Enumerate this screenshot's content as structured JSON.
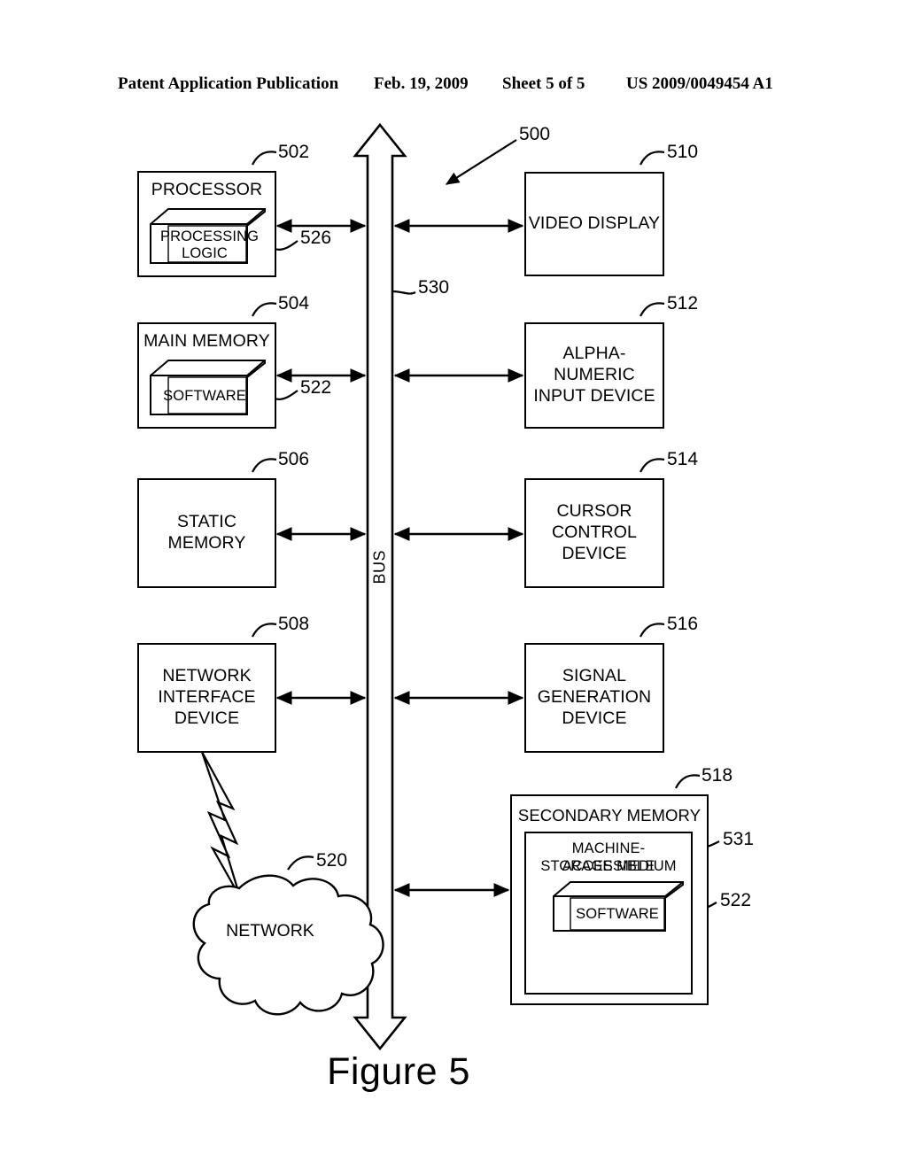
{
  "header": {
    "left": "Patent Application Publication",
    "date": "Feb. 19, 2009",
    "sheet": "Sheet 5 of 5",
    "number": "US 2009/0049454 A1"
  },
  "figure": {
    "caption": "Figure 5",
    "system_ref": "500",
    "bus": {
      "label": "BUS",
      "ref": "530"
    },
    "blocks": [
      {
        "id": "processor",
        "title": "PROCESSOR",
        "ref": "502",
        "inner": {
          "label": "PROCESSING LOGIC",
          "ref": "526"
        }
      },
      {
        "id": "main-memory",
        "title": "MAIN MEMORY",
        "ref": "504",
        "inner": {
          "label": "SOFTWARE",
          "ref": "522"
        }
      },
      {
        "id": "static-memory",
        "title": "STATIC MEMORY",
        "ref": "506"
      },
      {
        "id": "network-interface-device",
        "title": "NETWORK INTERFACE DEVICE",
        "ref": "508"
      },
      {
        "id": "video-display",
        "title": "VIDEO DISPLAY",
        "ref": "510"
      },
      {
        "id": "alpha-numeric-input-device",
        "title": "ALPHA-NUMERIC INPUT DEVICE",
        "ref": "512"
      },
      {
        "id": "cursor-control-device",
        "title": "CURSOR CONTROL DEVICE",
        "ref": "514"
      },
      {
        "id": "signal-generation-device",
        "title": "SIGNAL GENERATION DEVICE",
        "ref": "516"
      },
      {
        "id": "secondary-memory",
        "title": "SECONDARY MEMORY",
        "ref": "518",
        "inner": {
          "label": "MACHINE-ACCESSIBLE STORAGE MEDIUM",
          "ref": "531"
        },
        "inner2": {
          "label": "SOFTWARE",
          "ref": "522"
        }
      }
    ],
    "network": {
      "label": "NETWORK",
      "ref": "520"
    },
    "block_text": {
      "processor": "PROCESSOR",
      "processing_logic_line1": "PROCESSING",
      "processing_logic_line2": "LOGIC",
      "main_memory": "MAIN MEMORY",
      "software": "SOFTWARE",
      "static_memory": "STATIC MEMORY",
      "nid_line1": "NETWORK",
      "nid_line2": "INTERFACE",
      "nid_line3": "DEVICE",
      "video_display": "VIDEO DISPLAY",
      "ani_line1": "ALPHA-NUMERIC",
      "ani_line2": "INPUT DEVICE",
      "ccd_line1": "CURSOR",
      "ccd_line2": "CONTROL",
      "ccd_line3": "DEVICE",
      "sgd_line1": "SIGNAL",
      "sgd_line2": "GENERATION",
      "sgd_line3": "DEVICE",
      "secondary_memory": "SECONDARY MEMORY",
      "masm_line1": "MACHINE-ACCESSIBLE",
      "masm_line2": "STORAGE MEDIUM",
      "secondary_software": "SOFTWARE"
    },
    "refs": {
      "r500": "500",
      "r502": "502",
      "r504": "504",
      "r506": "506",
      "r508": "508",
      "r510": "510",
      "r512": "512",
      "r514": "514",
      "r516": "516",
      "r518": "518",
      "r520": "520",
      "r522a": "522",
      "r522b": "522",
      "r526": "526",
      "r530": "530",
      "r531": "531"
    }
  },
  "colors": {
    "ink": "#000000",
    "paper": "#ffffff"
  }
}
